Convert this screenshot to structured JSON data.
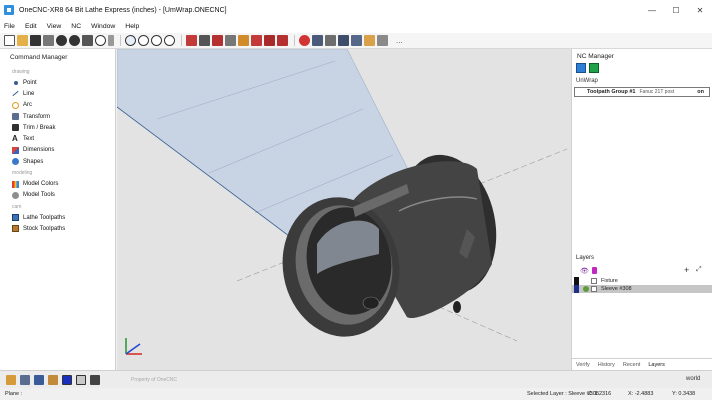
{
  "window": {
    "title": "OneCNC-XR8  64 Bit Lathe Express (inches) - [UmWrap.ONECNC]",
    "minimize": "—",
    "maximize": "☐",
    "close": "✕"
  },
  "menu": [
    "File",
    "Edit",
    "View",
    "NC",
    "Window",
    "Help"
  ],
  "toolbar_more": "...",
  "command_manager": {
    "title": "Command Manager",
    "sections": [
      {
        "label": "drawing",
        "items": [
          {
            "label": "Point",
            "icon": "point-icon"
          },
          {
            "label": "Line",
            "icon": "line-icon"
          },
          {
            "label": "Arc",
            "icon": "arc-icon"
          },
          {
            "label": "Transform",
            "icon": "transform-icon"
          },
          {
            "label": "Trim / Break",
            "icon": "trim-icon"
          },
          {
            "label": "Text",
            "icon": "text-icon"
          },
          {
            "label": "Dimensions",
            "icon": "dimensions-icon"
          },
          {
            "label": "Shapes",
            "icon": "shapes-icon"
          }
        ]
      },
      {
        "label": "modeling",
        "items": [
          {
            "label": "Model Colors",
            "icon": "model-colors-icon"
          },
          {
            "label": "Model Tools",
            "icon": "model-tools-icon"
          }
        ]
      },
      {
        "label": "cam",
        "items": [
          {
            "label": "Lathe Toolpaths",
            "icon": "lathe-toolpaths-icon"
          },
          {
            "label": "Stock Toolpaths",
            "icon": "stock-toolpaths-icon"
          }
        ]
      }
    ]
  },
  "nc_manager": {
    "title": "NC Manager",
    "subtitle": "UnWrap",
    "toolpath_group": {
      "name": "Toolpath Group #1",
      "post": "Fanuc 21T post",
      "state": "on"
    }
  },
  "layers": {
    "title": "Layers",
    "rows": [
      {
        "name": "Fixture",
        "selected": false
      },
      {
        "name": "Sleeve #308",
        "selected": true
      }
    ],
    "tabs": [
      "Verify",
      "History",
      "Recent",
      "Layers"
    ],
    "active_tab": "Layers"
  },
  "viewport": {
    "watermark": "Property of OneCNC"
  },
  "bottom_toolbar": {
    "coordinate_system": "world"
  },
  "status": {
    "mode": "Plane :",
    "selected_layer": "Selected Layer : Sleeve #308",
    "z": "Z: 1.2316",
    "x": "X: -2.4883",
    "y": "Y: 0.3438"
  },
  "colors": {
    "part": "#3a3a3a",
    "wrap_plane": "#c8d4e4",
    "accent_blue": "#2d7ed6",
    "layer_selected": "#c6c6c6"
  }
}
